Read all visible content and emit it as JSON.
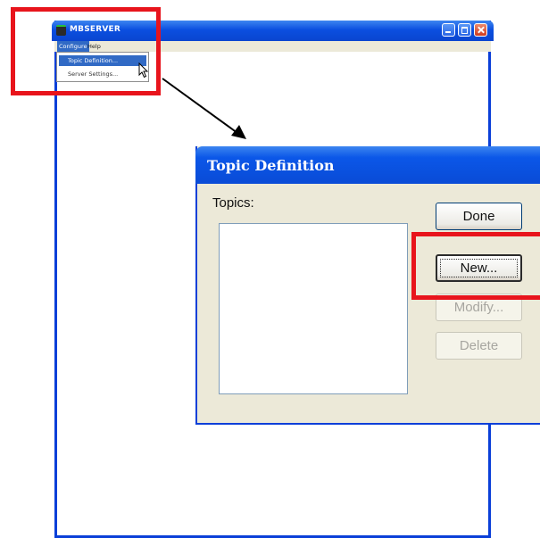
{
  "app": {
    "title": "MBSERVER",
    "menu": {
      "configure_label": "Configure",
      "help_label": "Help"
    },
    "dropdown": {
      "topic_label": "Topic Definition...",
      "server_label": "Server Settings..."
    }
  },
  "dialog": {
    "title": "Topic Definition",
    "topics_label": "Topics:",
    "buttons": {
      "done": "Done",
      "new": "New...",
      "modify": "Modify...",
      "delete": "Delete"
    }
  },
  "colors": {
    "titlebar_blue": "#0b4fe0",
    "highlight_red": "#e8141c",
    "dialog_face": "#ece9d8"
  }
}
